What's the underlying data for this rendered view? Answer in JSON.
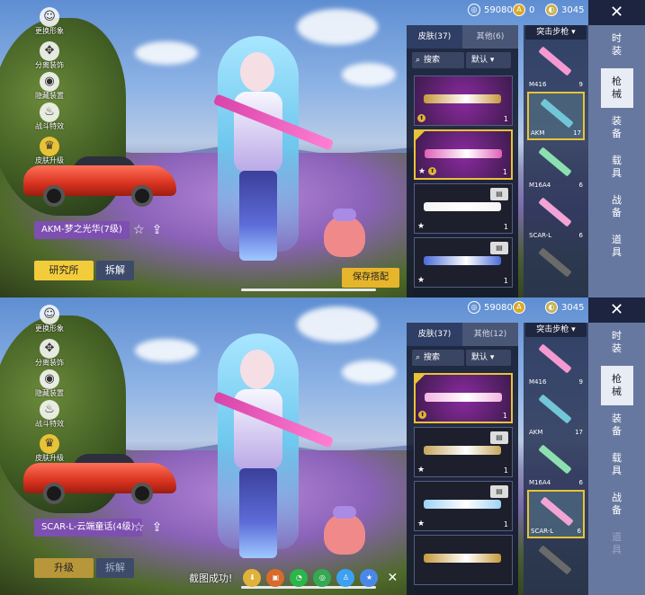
{
  "panels": [
    {
      "currency": {
        "silver": "59080",
        "gold": "0",
        "uc": "3045"
      },
      "tools": [
        "更换形象",
        "分离装饰",
        "隐藏装置",
        "战斗特效",
        "皮肤升级"
      ],
      "skin_label": "AKM-梦之光华(7级)",
      "left_button": "研究所",
      "right_button": "拆解",
      "save_button": "保存搭配",
      "skin_tabs": {
        "skins": "皮肤(37)",
        "other": "其他(6)"
      },
      "search_placeholder": "搜索",
      "sort_label": "默认",
      "weapon_type": "突击步枪",
      "skins": [
        {
          "count": "1",
          "color": "#c79a3c",
          "style": "purple",
          "selected": false,
          "star": false,
          "badge": true,
          "box": false
        },
        {
          "count": "1",
          "color": "#e060b8",
          "style": "purple",
          "selected": true,
          "star": true,
          "badge": true,
          "box": false
        },
        {
          "count": "1",
          "color": "#f4f4f4",
          "style": "silver",
          "selected": false,
          "star": true,
          "badge": false,
          "box": true
        },
        {
          "count": "1",
          "color": "#4a6cd8",
          "style": "silver",
          "selected": false,
          "star": true,
          "badge": false,
          "box": true
        }
      ],
      "weapons": [
        {
          "name": "M416",
          "count": "9",
          "color": "#f59ad0",
          "selected": false
        },
        {
          "name": "AKM",
          "count": "17",
          "color": "#72c6d8",
          "selected": true
        },
        {
          "name": "M16A4",
          "count": "6",
          "color": "#8ce0b0",
          "selected": false
        },
        {
          "name": "SCAR-L",
          "count": "6",
          "color": "#f2a4d6",
          "selected": false
        },
        {
          "name": "",
          "count": "",
          "color": "#6a6a6a",
          "selected": false
        }
      ],
      "categories": [
        {
          "label": "时装",
          "active": false
        },
        {
          "label": "枪械",
          "active": true
        },
        {
          "label": "装备",
          "active": false
        },
        {
          "label": "载具",
          "active": false
        },
        {
          "label": "战备",
          "active": false
        },
        {
          "label": "道具",
          "active": false
        }
      ]
    },
    {
      "currency": {
        "silver": "59080",
        "gold": "",
        "uc": "3045"
      },
      "tools": [
        "更换形象",
        "分离装饰",
        "隐藏装置",
        "战斗特效",
        "皮肤升级"
      ],
      "skin_label": "SCAR-L-云端童话(4级)",
      "left_button": "升级",
      "right_button": "拆解",
      "save_button": "",
      "skin_tabs": {
        "skins": "皮肤(37)",
        "other": "其他(12)"
      },
      "search_placeholder": "搜索",
      "sort_label": "默认",
      "weapon_type": "突击步枪",
      "skins": [
        {
          "count": "1",
          "color": "#f2b6e0",
          "style": "purple",
          "selected": true,
          "star": false,
          "badge": true,
          "box": false
        },
        {
          "count": "1",
          "color": "#c7a65c",
          "style": "silver",
          "selected": false,
          "star": true,
          "badge": false,
          "box": true
        },
        {
          "count": "1",
          "color": "#9fd3f4",
          "style": "silver",
          "selected": false,
          "star": true,
          "badge": false,
          "box": true
        },
        {
          "count": "",
          "color": "#c79a3c",
          "style": "silver",
          "selected": false,
          "star": false,
          "badge": false,
          "box": false
        }
      ],
      "weapons": [
        {
          "name": "M416",
          "count": "9",
          "color": "#f59ad0",
          "selected": false
        },
        {
          "name": "AKM",
          "count": "17",
          "color": "#72c6d8",
          "selected": false
        },
        {
          "name": "M16A4",
          "count": "6",
          "color": "#8ce0b0",
          "selected": false
        },
        {
          "name": "SCAR-L",
          "count": "6",
          "color": "#f2a4d6",
          "selected": true
        },
        {
          "name": "",
          "count": "",
          "color": "#6a6a6a",
          "selected": false
        }
      ],
      "categories": [
        {
          "label": "时装",
          "active": false
        },
        {
          "label": "枪械",
          "active": true
        },
        {
          "label": "装备",
          "active": false
        },
        {
          "label": "载具",
          "active": false
        },
        {
          "label": "战备",
          "active": false
        },
        {
          "label": "道具",
          "active": false
        }
      ]
    }
  ],
  "toast": "截图成功!",
  "share_icons": [
    "download-icon",
    "peace-elite-icon",
    "wechat-icon",
    "moments-icon",
    "qq-icon",
    "qzone-icon",
    "close-icon"
  ]
}
